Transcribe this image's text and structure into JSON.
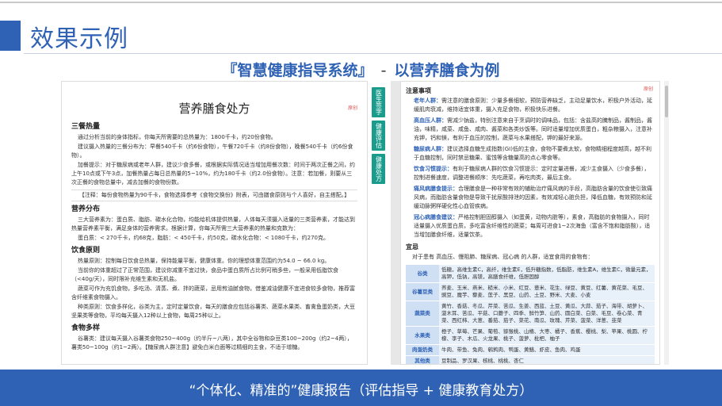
{
  "slide": {
    "title": "效果示例",
    "subtitle_left": "『智慧健康指导系统』",
    "subtitle_sep": "-",
    "subtitle_right": "以营养膳食为例",
    "footer": "“个体化、精准的”健康报告（评估指导 + 健康教育处方）"
  },
  "left_doc": {
    "title": "营养膳食处方",
    "tag": "原创",
    "sections": [
      {
        "heading": "三餐热量",
        "paras": [
          "通过分析当前的身体指标，你每天所需要的总热量为：1800千卡，约20份食物。",
          "建议摄入热量的三餐分布为：早餐540千卡（约6份食物），午餐720千卡（约8份食物），晚餐540千卡（约6份食物）。",
          "加餐提示：对于糖尿病或老年人群，建议少食多餐，或根据实际情况适当增加用餐次数：时间于两次正餐之间，约上午10点或下午3点，加餐热量占每日总热量的5~10%，约为180千卡（约2.0份食物）。注意：若加餐，则要从三次正餐的食物总量中，减去加餐的食物份数。"
        ],
        "note": "【注释：每份食物热量为90千卡，食物选择参考《食物交换份》附表，可由膳食原则与个人喜好，自主搭配。】"
      },
      {
        "heading": "营养分布",
        "paras": [
          "三大营养素为：蛋白质、脂肪、碳水化合物，均能给机体提供热量，人体每天须摄入适量的三类营养素，才能达到热量营养素平衡，满足身体的营养需求。根据计算，你每天所需三大营养素的热量和克数为：",
          "蛋白质：< 270千卡，约68克，脂肪：< 450千卡，约50克，碳水化合物：< 1080千卡，约270克。"
        ]
      },
      {
        "heading": "饮食原则",
        "paras": [
          "热量原则：控制每日饮食总热量，保持能量平衡，健康体重。你的理想体重范围约为54.0 ~ 66.0 kg。",
          "当前你的体重超过了正常范围，建议你减重不宜过快，食品中蛋白质所占比例可稍多些，一般采用低脂饮食（<40g/天），同时限补充维生素和无机盐。",
          "蔬菜可作为充饥食物，多吃汤、清蒸、煮、拌的蔬菜，忌用煎油腻食物，借鉴减油健康不宜进食较多食物，推荐富含纤维素食物摄入。",
          "种类原则：饮食多样化，谷类为主，定时定量饮食，每天的膳食应包括谷薯类、蔬菜水果类、畜禽鱼蛋奶类，大豆坚果类等食物，平均每天摄入12种以上食物，每周25种以上。"
        ]
      },
      {
        "heading": "食物多样",
        "paras": [
          "谷薯类：建议每天摄入谷薯类食物250~400g（约半斤~八两），其中全谷物和杂豆类100~200g（约2~4两），薯类50~100g（约1~2两）。【糖尿病人群注意】避免白米白面等过精细的主食，不适于增糖。"
        ]
      }
    ]
  },
  "side_tabs": [
    "医生签字",
    "健康评估",
    "健康处方"
  ],
  "right_doc": {
    "heading": "注意事项",
    "tag": "原创",
    "items": [
      {
        "label": "老年人群：",
        "text": "需注意的膳食原则：少量多餐细软，预防营养缺乏，主动足量饮水，积极户外活动，延缓肌肉衰减，维持适宜体重，摄入充足食物，积极快乐进餐。"
      },
      {
        "label": "高血压人群：",
        "text": "需减少钠盐，特别注意来自于烹调时的调味品，包括：含盐高的腌制品，酱制品，酱油，味精，咸菜、咸鱼、咸肉、酱菜和各类炒饭等。同时适量增加优质蛋白，粗杂粮摄入，注意补充钾，钙和镁，有利于血压的控制，蔬菜与水果搭配，钾的最好来源。"
      },
      {
        "label": "糖尿病人群：",
        "text": "建议选择血糖生成指数(GI)低的主食，食物不要煮太软，食物精细程度越高，越不利于血糖控制，同时禁忌糖果、蜜饯等含糖量高的点心零食等。"
      },
      {
        "label": "饮食习惯提示：",
        "text": "有利于糖尿病人群的饮食习惯提示：定时定量进餐，减少主食摄入（少食多餐），控制进餐速度，调整进餐顺序：先吃蔬菜，再吃肉类，最后主食。"
      },
      {
        "label": "痛风病膳食提示：",
        "text": "合理膳食是一种非常有效的辅助治疗痛风病的手段，高脂肪含量的饮食使引致痛风病，而脂肪含量食物是导致干扰尿酸排泄的因素，有效减轻心脏负担，降低血糖，有效预防和延缓动脉粥样硬化性心血管疾病。"
      },
      {
        "label": "冠心病膳食建议：",
        "text": "严格控制胆固醇摄入（如蛋黄，动物内脏等），素食，高脂肪的食物摄入，同时适量摄入优质蛋白质，多吃富含纤维性的蔬菜；每周可进食1~2次海鱼（富含不饱和脂肪酸），适当增加膳食纤维，适量饮茶。"
      }
    ],
    "diet_heading": "宜忌",
    "diet_intro": "对于患有 高血压、慢阻肺、糖尿病、冠心病 的人群，适宜食用的食物有：",
    "rows": [
      {
        "cat": "谷类",
        "items": "低糖，高维生素C，高纤，维生素E，低升糖指数，低脂肪，维生素A，维生素C，微量元素，高钾，低钠，高镁，高膳食纤维，低胆固醇"
      },
      {
        "cat": "谷薯豆类",
        "items": "荞麦、玉米、燕米、糙米、小米、红豆、薏米、花生、绿豆、黄豆、红薯、黄花菜、毛豆、豌豆、魔芋、藜麦、莲子、黑豆、山药、土豆、野米、大麦、小麦"
      },
      {
        "cat": "蔬菜类",
        "items": "黄竹、香菇、冬瓜、芹菜、苦瓜、生姜、西蓝、土豆、黄瓜、大蒜、茄子、海带、胡萝卜、菠木耳、苦瓜、平菇、口蘑子、四季、鲜竹笋、山药、圆白菜、白菜、毛豆、卷心菜、青菜、西红柿、大葱、番茄、茄子、菜花、南瓜、玫瑰、芹菜、菠菜、洋葱、韭菜"
      },
      {
        "cat": "水果类",
        "items": "橙子、草莓、芒果、葡萄、猕猴桃、山楂、大枣、橘子、香蕉、樱桃、梨、苹果、桃圆、柠檬、李子、木瓜、火龙果、桃子、菠萝、枇杷、柚子"
      },
      {
        "cat": "肉蛋奶类",
        "items": "牛肉、带鱼、兔肉、鹌鹑肉、鸭蛋、黄鳝、虾皮、鱼肉、鸡蛋"
      },
      {
        "cat": "其他类",
        "items": "豆制品、罗汉果、核桃、桃桃、杏仁"
      }
    ]
  }
}
